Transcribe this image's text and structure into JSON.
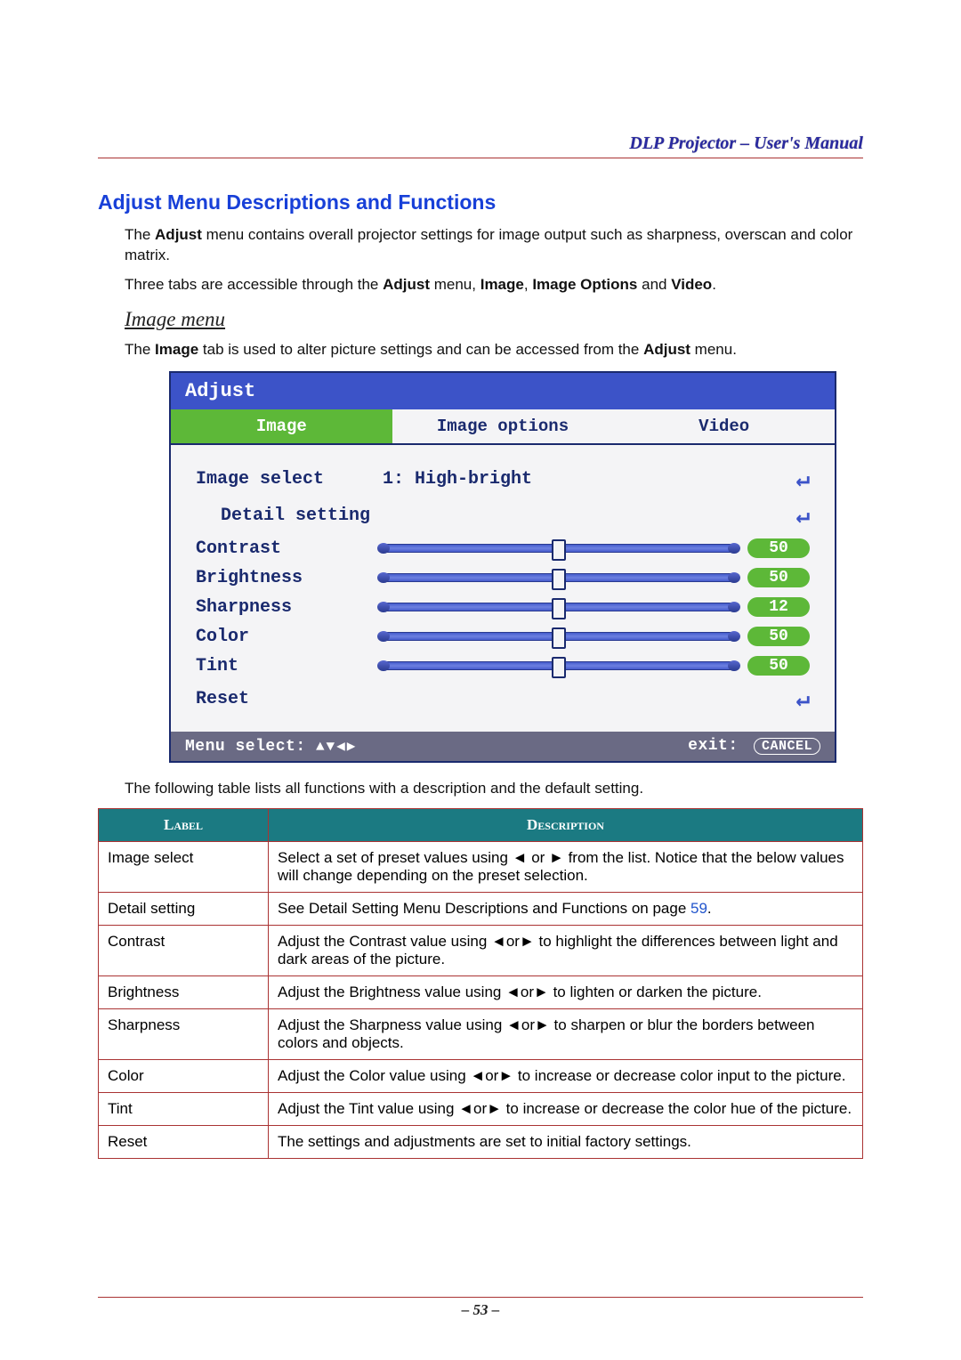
{
  "header": {
    "title": "DLP Projector – User's Manual"
  },
  "page_number": "– 53 –",
  "heading": "Adjust Menu Descriptions and Functions",
  "intro_parts": {
    "p1a": "The ",
    "p1b": "Adjust",
    "p1c": " menu contains overall projector settings for image output such as sharpness, overscan and color matrix.",
    "p2a": "Three tabs are accessible through the ",
    "p2b": "Adjust",
    "p2c": " menu, ",
    "p2d": "Image",
    "p2e": ", ",
    "p2f": "Image Options",
    "p2g": " and ",
    "p2h": "Video",
    "p2i": "."
  },
  "sub_heading": "Image menu",
  "image_intro": {
    "a": "The ",
    "b": "Image",
    "c": " tab is used to alter picture settings and can be accessed from the ",
    "d": "Adjust",
    "e": " menu."
  },
  "osd": {
    "title": "Adjust",
    "tabs": [
      "Image",
      "Image options",
      "Video"
    ],
    "items": {
      "image_select": {
        "label": "Image select",
        "value": "1: High-bright"
      },
      "detail_setting": {
        "label": "Detail setting"
      },
      "contrast": {
        "label": "Contrast",
        "value": "50"
      },
      "brightness": {
        "label": "Brightness",
        "value": "50"
      },
      "sharpness": {
        "label": "Sharpness",
        "value": "12"
      },
      "color": {
        "label": "Color",
        "value": "50"
      },
      "tint": {
        "label": "Tint",
        "value": "50"
      },
      "reset": {
        "label": "Reset"
      }
    },
    "footer": {
      "menu_select": "Menu select:",
      "arrows": "▲▼◀▶",
      "exit_label": "exit:",
      "cancel": "CANCEL"
    }
  },
  "table_intro": "The following table lists all functions with a description and the default setting.",
  "table": {
    "headers": {
      "label": "Label",
      "description": "Description"
    },
    "rows": [
      {
        "label": "Image select",
        "desc": "Select a set of preset values using ◄ or ► from the list. Notice that the below values will change depending on the preset selection."
      },
      {
        "label": "Detail setting",
        "desc": "See Detail Setting Menu Descriptions and Functions on page ",
        "page_ref": "59",
        "tail": "."
      },
      {
        "label": "Contrast",
        "desc": "Adjust the Contrast value using ◄or► to highlight the differences between light and dark areas of the picture."
      },
      {
        "label": "Brightness",
        "desc": "Adjust the Brightness value using ◄or► to lighten or darken the picture."
      },
      {
        "label": "Sharpness",
        "desc": "Adjust the Sharpness value using ◄or► to sharpen or blur the borders between colors and objects."
      },
      {
        "label": "Color",
        "desc": "Adjust the Color value using ◄or► to increase or decrease color input to the picture."
      },
      {
        "label": "Tint",
        "desc": "Adjust the Tint value using ◄or► to increase or decrease the color hue of the picture."
      },
      {
        "label": "Reset",
        "desc": "The settings and adjustments are set to initial factory settings."
      }
    ]
  }
}
